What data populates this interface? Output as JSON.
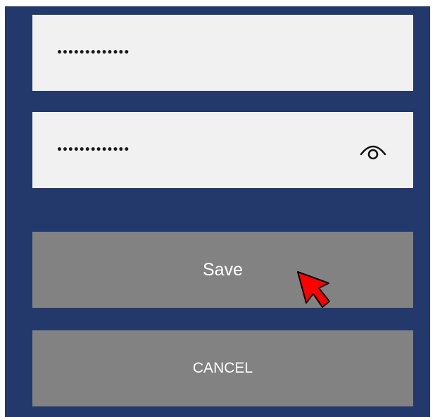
{
  "form": {
    "password_field": {
      "value": "•••••••••••••"
    },
    "confirm_password_field": {
      "value": "•••••••••••••"
    },
    "reveal_icon": "eye-icon",
    "save_label": "Save",
    "cancel_label": "CANCEL"
  },
  "colors": {
    "background": "#23396b",
    "field": "#f1f1f1",
    "button": "#828282",
    "button_text": "#ffffff",
    "cursor": "#ff0000"
  }
}
